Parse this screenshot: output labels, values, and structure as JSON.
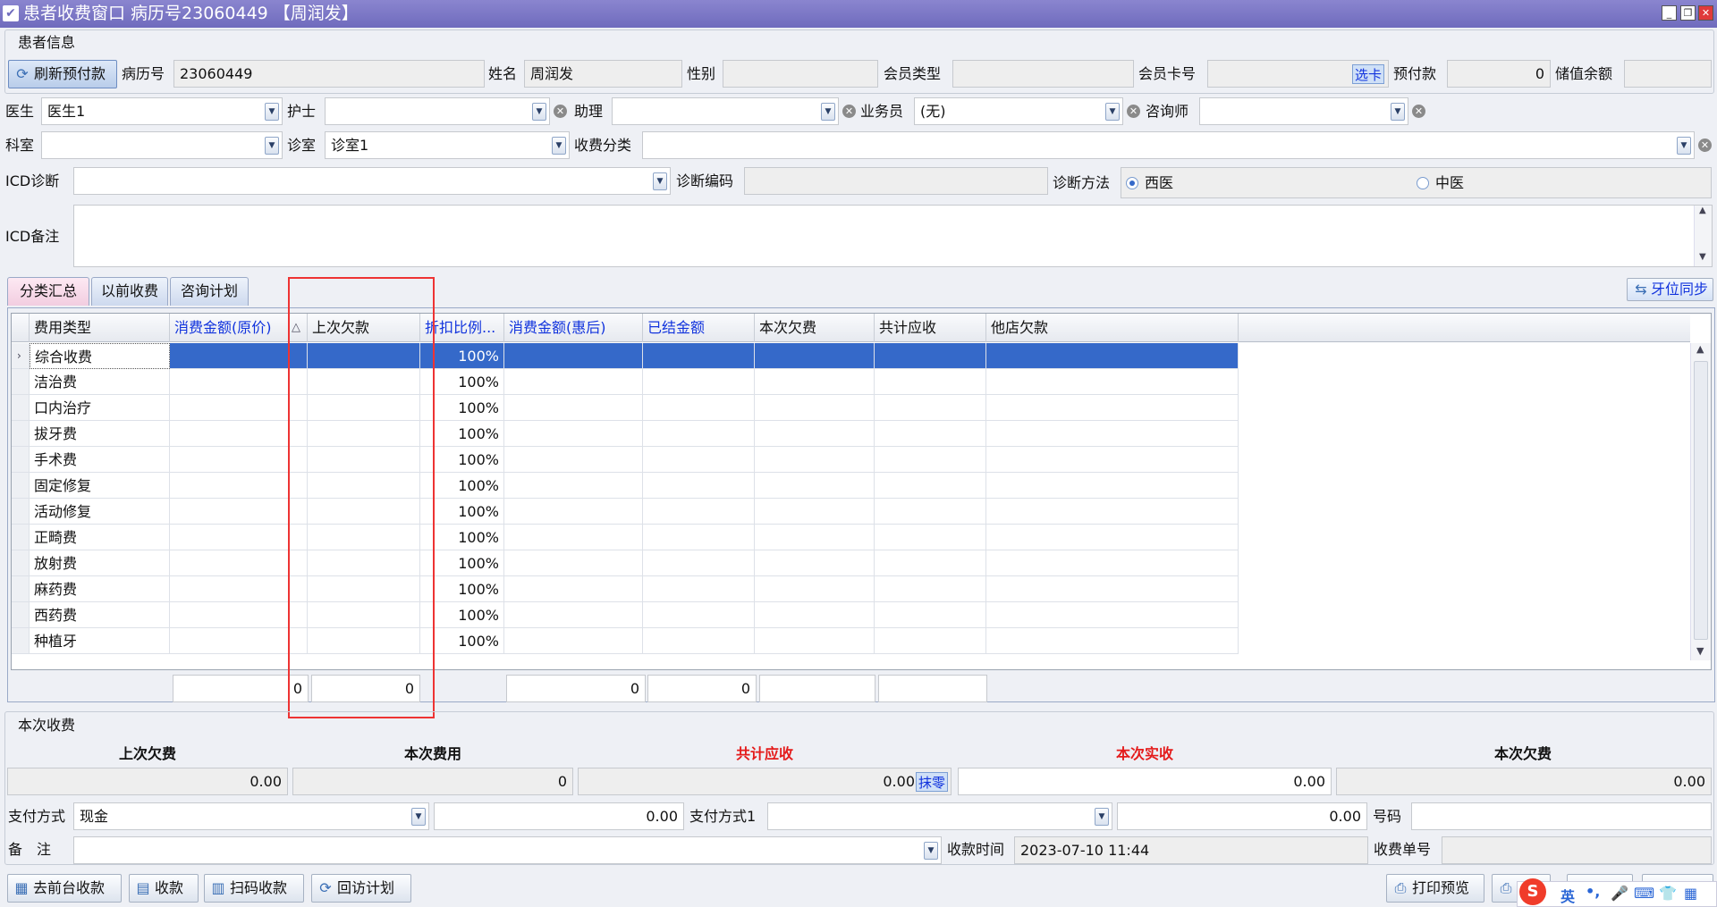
{
  "window": {
    "title": "患者收费窗口  病历号23060449 【周润发】",
    "check_icon": "check-icon",
    "btn_min": "minimize-icon",
    "btn_restore": "restore-icon",
    "btn_close": "close-icon"
  },
  "patient": {
    "group_label": "患者信息",
    "refresh_btn": "刷新预付款",
    "record_no_label": "病历号",
    "record_no": "23060449",
    "name_label": "姓名",
    "name": "周润发",
    "gender_label": "性别",
    "gender": "",
    "member_type_label": "会员类型",
    "member_type": "",
    "member_card_label": "会员卡号",
    "member_card": "",
    "select_card": "选卡",
    "prepay_label": "预付款",
    "prepay": "0",
    "balance_label": "储值余额",
    "balance": ""
  },
  "staff": {
    "doctor_label": "医生",
    "doctor": "医生1",
    "nurse_label": "护士",
    "nurse": "",
    "assistant_label": "助理",
    "assistant": "",
    "salesman_label": "业务员",
    "salesman": "(无)",
    "consultant_label": "咨询师",
    "consultant": "",
    "dept_label": "科室",
    "dept": "",
    "room_label": "诊室",
    "room": "诊室1",
    "fee_class_label": "收费分类",
    "fee_class": ""
  },
  "icd": {
    "diag_label": "ICD诊断",
    "diag": "",
    "code_label": "诊断编码",
    "code": "",
    "method_label": "诊断方法",
    "opt_western": "西医",
    "opt_chinese": "中医",
    "note_label": "ICD备注",
    "note": ""
  },
  "tabs": [
    {
      "label": "分类汇总"
    },
    {
      "label": "以前收费"
    },
    {
      "label": "咨询计划"
    }
  ],
  "tooth_sync": "牙位同步",
  "grid": {
    "headers": [
      "费用类型",
      "消费金额(原价)",
      "上次欠款",
      "折扣比例...",
      "消费金额(惠后)",
      "已结金额",
      "本次欠费",
      "共计应收",
      "他店欠款"
    ],
    "sort_mark": "△",
    "rows": [
      {
        "type": "综合收费",
        "discount": "100%"
      },
      {
        "type": "洁治费",
        "discount": "100%"
      },
      {
        "type": "口内治疗",
        "discount": "100%"
      },
      {
        "type": "拔牙费",
        "discount": "100%"
      },
      {
        "type": "手术费",
        "discount": "100%"
      },
      {
        "type": "固定修复",
        "discount": "100%"
      },
      {
        "type": "活动修复",
        "discount": "100%"
      },
      {
        "type": "正畸费",
        "discount": "100%"
      },
      {
        "type": "放射费",
        "discount": "100%"
      },
      {
        "type": "麻药费",
        "discount": "100%"
      },
      {
        "type": "西药费",
        "discount": "100%"
      },
      {
        "type": "种植牙",
        "discount": "100%"
      }
    ],
    "footer": {
      "orig": "0",
      "last_debt": "0",
      "after": "0",
      "settled": "0"
    }
  },
  "charge": {
    "group_label": "本次收费",
    "h_last_debt": "上次欠费",
    "h_this_fee": "本次费用",
    "h_total": "共计应收",
    "h_actual": "本次实收",
    "h_this_debt": "本次欠费",
    "last_debt": "0.00",
    "this_fee": "0",
    "total": "0.00",
    "round_btn": "抹零",
    "actual": "0.00",
    "this_debt": "0.00",
    "pay_label": "支付方式",
    "pay": "现金",
    "pay_amount": "0.00",
    "pay1_label": "支付方式1",
    "pay1": "",
    "pay1_amount": "0.00",
    "num_label": "号码",
    "num": "",
    "note_label": "备　注",
    "note": "",
    "time_label": "收款时间",
    "time": "2023-07-10 11:44",
    "receipt_label": "收费单号",
    "receipt": ""
  },
  "toolbar": {
    "front_desk": "去前台收款",
    "collect": "收款",
    "scan": "扫码收款",
    "revisit": "回访计划",
    "print_preview": "打印预览"
  },
  "ime": {
    "lang": "英"
  }
}
